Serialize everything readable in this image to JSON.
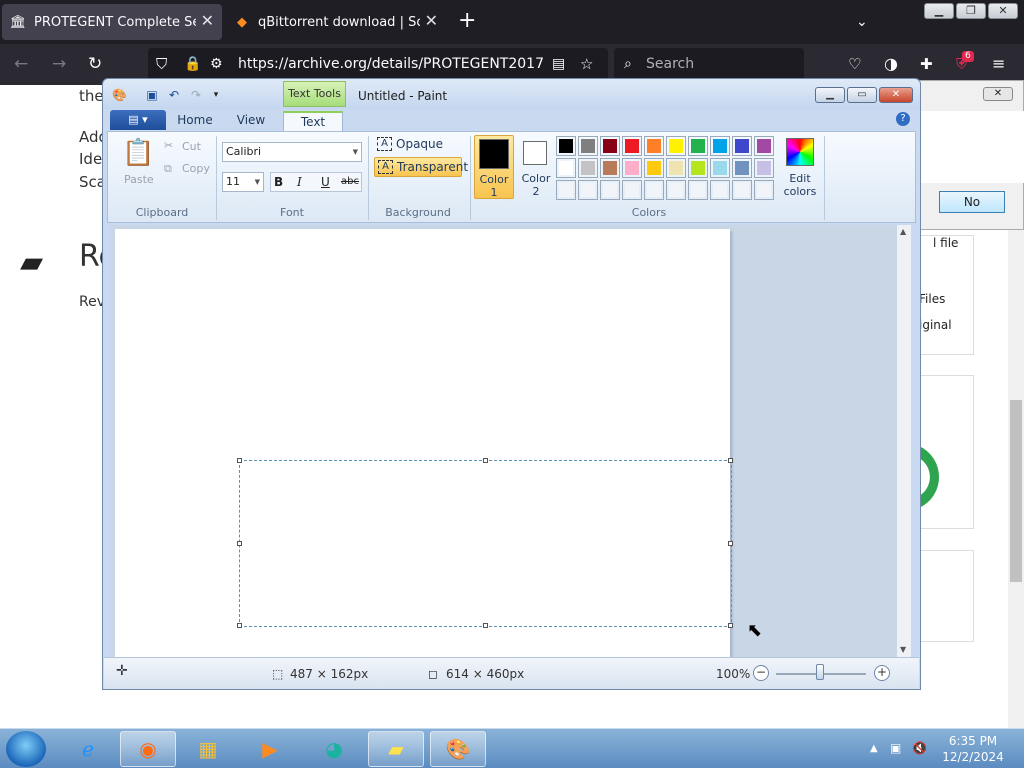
{
  "browser": {
    "tabs": [
      {
        "title": "PROTEGENT Complete Security",
        "active": true,
        "icon": "archive-icon"
      },
      {
        "title": "qBittorrent download | SourceF",
        "active": false,
        "icon": "sourceforge-icon"
      }
    ],
    "url": "https://archive.org/details/PROTEGENT2017",
    "search_placeholder": "Search",
    "extension_badge": "6"
  },
  "webpage": {
    "line_fragments": [
      "the",
      "Add",
      "Ide",
      "Sca"
    ],
    "heading_fragment": "Re",
    "reviews_fragment": "Rev",
    "side_fragments": [
      "l file",
      "Files",
      "iginal"
    ],
    "dialog": {
      "no_label": "No",
      "close_label": "✕"
    }
  },
  "paint": {
    "window_title": "Untitled - Paint",
    "context_tab": "Text Tools",
    "ribbon_tabs": [
      "Home",
      "View",
      "Text"
    ],
    "active_tab": "Text",
    "clipboard": {
      "paste": "Paste",
      "cut": "Cut",
      "copy": "Copy",
      "label": "Clipboard"
    },
    "font": {
      "family": "Calibri",
      "size": "11",
      "label": "Font",
      "bold": "B",
      "italic": "I",
      "underline": "U",
      "strike": "abc"
    },
    "background": {
      "opaque": "Opaque",
      "transparent": "Transparent",
      "label": "Background",
      "selected": "Transparent"
    },
    "colors": {
      "color1": "Color\n1",
      "color1_top": "Color",
      "color1_num": "1",
      "color2_top": "Color",
      "color2_num": "2",
      "label": "Colors",
      "edit": "Edit",
      "edit2": "colors",
      "color1_value": "#000000",
      "color2_value": "#ffffff",
      "palette_row1": [
        "#000000",
        "#7f7f7f",
        "#880015",
        "#ed1c24",
        "#ff7f27",
        "#fff200",
        "#22b14c",
        "#00a2e8",
        "#3f48cc",
        "#a349a4"
      ],
      "palette_row2": [
        "#ffffff",
        "#c3c3c3",
        "#b97a57",
        "#ffaec9",
        "#ffc90e",
        "#efe4b0",
        "#b5e61d",
        "#99d9ea",
        "#7092be",
        "#c8bfe7"
      ]
    },
    "status": {
      "selection_size": "487 × 162px",
      "image_size": "614 × 460px",
      "zoom": "100%"
    }
  },
  "taskbar": {
    "time": "6:35 PM",
    "date": "12/2/2024"
  }
}
